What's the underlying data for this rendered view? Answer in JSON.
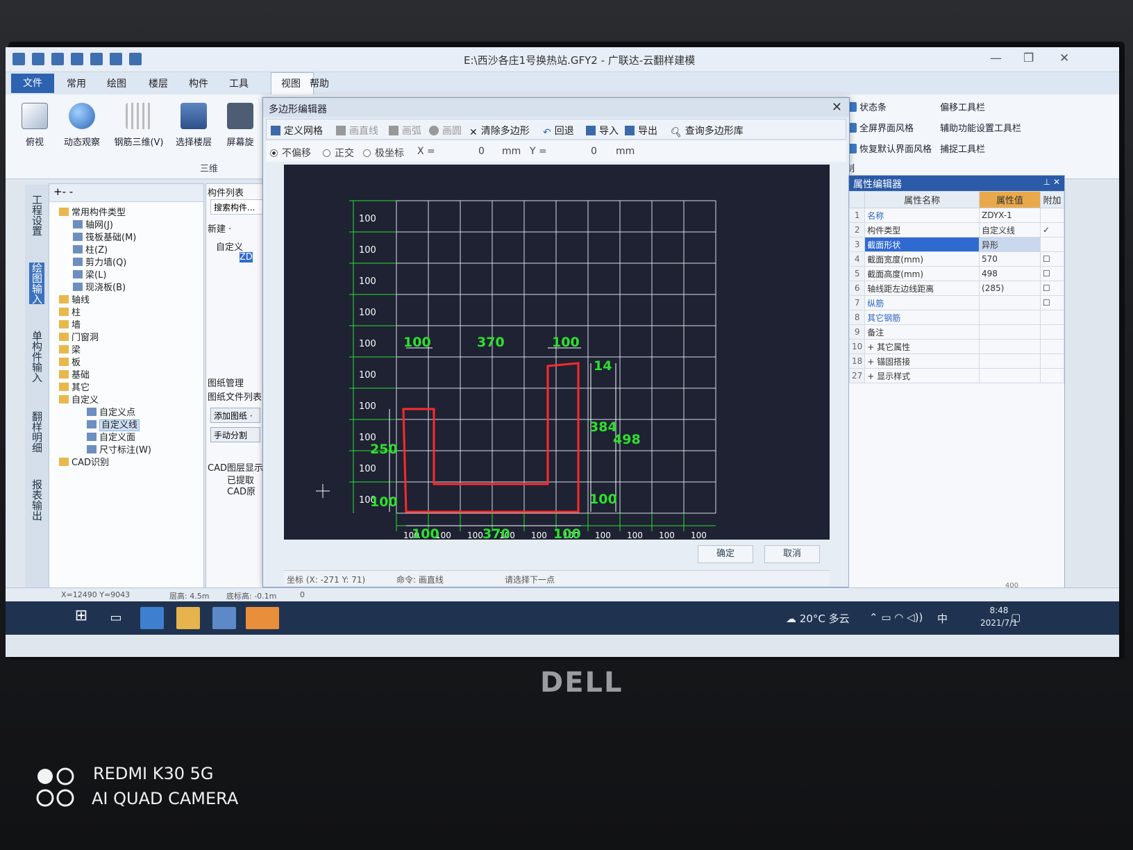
{
  "app": {
    "title": "E:\\西沙各庄1号换热站.GFY2 - 广联达-云翻样建模"
  },
  "menu": {
    "file": "文件",
    "tabs": [
      "常用",
      "绘图",
      "楼层",
      "构件",
      "工具",
      "视图",
      "帮助"
    ],
    "active_tab": "视图"
  },
  "ribbon": {
    "buttons": [
      "俯视",
      "动态观察",
      "钢筋三维(V)",
      "选择楼层",
      "屏幕旋"
    ],
    "group_label": "三维",
    "right_items": [
      "状态条",
      "全屏界面风格",
      "恢复默认界面风格",
      "偏移工具栏",
      "辅助功能设置工具栏",
      "捕捉工具栏"
    ],
    "right_group_label": "制"
  },
  "sidebar": {
    "tabs": [
      "工程设置",
      "绘图输入",
      "单构件输入",
      "翻样明细",
      "报表输出"
    ]
  },
  "tree": {
    "toolbar": "+- -",
    "items": [
      {
        "label": "常用构件类型",
        "level": 0
      },
      {
        "label": "轴网(J)",
        "level": 1
      },
      {
        "label": "筏板基础(M)",
        "level": 1
      },
      {
        "label": "柱(Z)",
        "level": 1
      },
      {
        "label": "剪力墙(Q)",
        "level": 1
      },
      {
        "label": "梁(L)",
        "level": 1
      },
      {
        "label": "现浇板(B)",
        "level": 1
      },
      {
        "label": "轴线",
        "level": 0
      },
      {
        "label": "柱",
        "level": 0
      },
      {
        "label": "墙",
        "level": 0
      },
      {
        "label": "门窗洞",
        "level": 0
      },
      {
        "label": "梁",
        "level": 0
      },
      {
        "label": "板",
        "level": 0
      },
      {
        "label": "基础",
        "level": 0
      },
      {
        "label": "其它",
        "level": 0
      },
      {
        "label": "自定义",
        "level": 0
      },
      {
        "label": "自定义点",
        "level": 2
      },
      {
        "label": "自定义线",
        "level": 2,
        "selected": true
      },
      {
        "label": "自定义面",
        "level": 2
      },
      {
        "label": "尺寸标注(W)",
        "level": 2
      },
      {
        "label": "CAD识别",
        "level": 0
      }
    ]
  },
  "component_list": {
    "header": "构件列表",
    "search_placeholder": "搜索构件...",
    "new_button": "新建 ·",
    "tree_item": "自定义",
    "tree_child": "ZD",
    "drawing_header": "图纸管理",
    "drawing_list": "图纸文件列表",
    "add_drawing": "添加图纸 ·",
    "manual_split": "手动分割",
    "cad_layer": "CAD图层显示",
    "extracted": "已提取",
    "cad_origin": "CAD原"
  },
  "dialog": {
    "title": "多边形编辑器",
    "toolbar": [
      {
        "label": "定义网格",
        "enabled": true
      },
      {
        "label": "画直线",
        "enabled": false
      },
      {
        "label": "画弧",
        "enabled": false
      },
      {
        "label": "画圆",
        "enabled": false
      },
      {
        "label": "清除多边形",
        "enabled": true
      },
      {
        "label": "回退",
        "enabled": true
      },
      {
        "label": "导入",
        "enabled": true
      },
      {
        "label": "导出",
        "enabled": true
      },
      {
        "label": "查询多边形库",
        "enabled": true
      }
    ],
    "options": {
      "radios": [
        "不偏移",
        "正交",
        "极坐标"
      ],
      "selected": "不偏移",
      "x_label": "X =",
      "x_value": "0",
      "y_label": "Y =",
      "y_value": "0",
      "unit": "mm"
    },
    "ok": "确定",
    "cancel": "取消",
    "status": {
      "coord": "坐标 (X: -271 Y: 71)",
      "command": "命令: 画直线",
      "prompt": "请选择下一点"
    }
  },
  "canvas": {
    "left_labels": [
      "100",
      "100",
      "100",
      "100",
      "100",
      "100",
      "100",
      "100",
      "100",
      "100"
    ],
    "bottom_labels": [
      "100",
      "100",
      "100",
      "100",
      "100",
      "100",
      "100",
      "100",
      "100",
      "100"
    ],
    "dim_labels": {
      "top_a": "100",
      "top_b": "370",
      "top_c": "100",
      "right_top": "14",
      "right_mid": "384",
      "right_total": "498",
      "right_bottom": "100",
      "left_mid": "250",
      "left_bottom": "100",
      "bottom_a": "100",
      "bottom_b": "370",
      "bottom_c": "100"
    },
    "colors": {
      "background": "#1e2233",
      "grid": "#d8dce6",
      "polygon": "#ff2a2a",
      "dimension": "#2fe02f"
    }
  },
  "property_editor": {
    "title": "属性编辑器",
    "columns": [
      "属性名称",
      "属性值",
      "附加"
    ],
    "rows": [
      {
        "no": "1",
        "name": "名称",
        "value": "ZDYX-1",
        "check": "",
        "blue": true
      },
      {
        "no": "2",
        "name": "构件类型",
        "value": "自定义线",
        "check": "✓",
        "blue": false
      },
      {
        "no": "3",
        "name": "截面形状",
        "value": "异形",
        "check": "",
        "blue": false,
        "selected": true
      },
      {
        "no": "4",
        "name": "截面宽度(mm)",
        "value": "570",
        "check": "☐",
        "blue": false
      },
      {
        "no": "5",
        "name": "截面高度(mm)",
        "value": "498",
        "check": "☐",
        "blue": false
      },
      {
        "no": "6",
        "name": "轴线距左边线距离",
        "value": "(285)",
        "check": "☐",
        "blue": false
      },
      {
        "no": "7",
        "name": "纵筋",
        "value": "",
        "check": "☐",
        "blue": true
      },
      {
        "no": "8",
        "name": "其它钢筋",
        "value": "",
        "check": "",
        "blue": true
      },
      {
        "no": "9",
        "name": "备注",
        "value": "",
        "check": "",
        "blue": false
      },
      {
        "no": "10",
        "name": "+ 其它属性",
        "value": "",
        "check": "",
        "blue": false
      },
      {
        "no": "18",
        "name": "+ 锚固搭接",
        "value": "",
        "check": "",
        "blue": false
      },
      {
        "no": "27",
        "name": "+ 显示样式",
        "value": "",
        "check": "",
        "blue": false
      }
    ],
    "corner_value": "400"
  },
  "statusbar": {
    "coords": "X=12490 Y=9043",
    "floor_height": "层高: 4.5m",
    "base_height": "底标高: -0.1m",
    "value": "0"
  },
  "taskbar": {
    "weather": "20°C 多云",
    "ime": "中",
    "time": "8:48",
    "date": "2021/7/1"
  },
  "device": {
    "brand": "DELL",
    "camera_line1": "REDMI K30 5G",
    "camera_line2": "AI QUAD CAMERA"
  }
}
